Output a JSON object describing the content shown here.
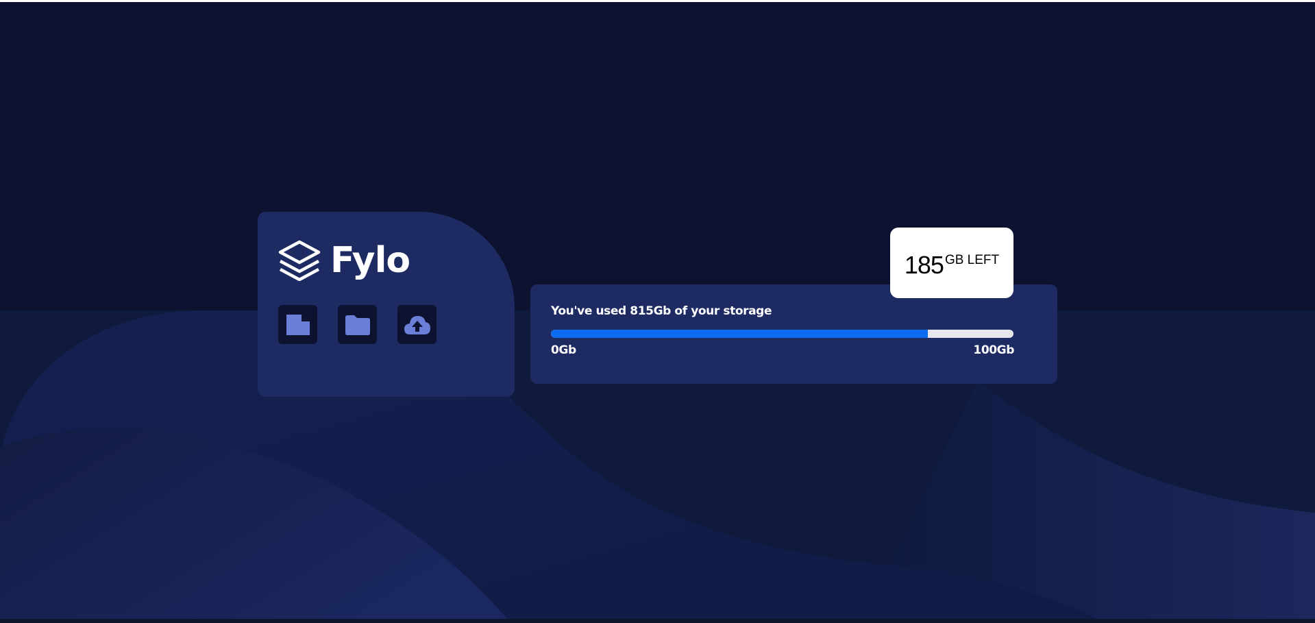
{
  "brand": {
    "name": "Fylo",
    "logo_icon": "layers-icon"
  },
  "toolbar": {
    "buttons": [
      {
        "icon": "document-icon"
      },
      {
        "icon": "folder-icon"
      },
      {
        "icon": "cloud-upload-icon"
      }
    ]
  },
  "storage": {
    "usage_text": "You've used 815Gb of your storage",
    "used_fraction": 0.815,
    "min_label": "0Gb",
    "max_label": "100Gb",
    "remaining_value": "185",
    "remaining_unit": "GB LEFT"
  },
  "colors": {
    "page_background": "#0c1230",
    "card_background": "#1e2b63",
    "icon_tile": "#0c1230",
    "icon_fill": "#6b7ed8",
    "progress_fill": "#0b6cf0",
    "progress_track": "#e6e6ec",
    "badge_background": "#ffffff",
    "text_light": "#ffffff"
  }
}
